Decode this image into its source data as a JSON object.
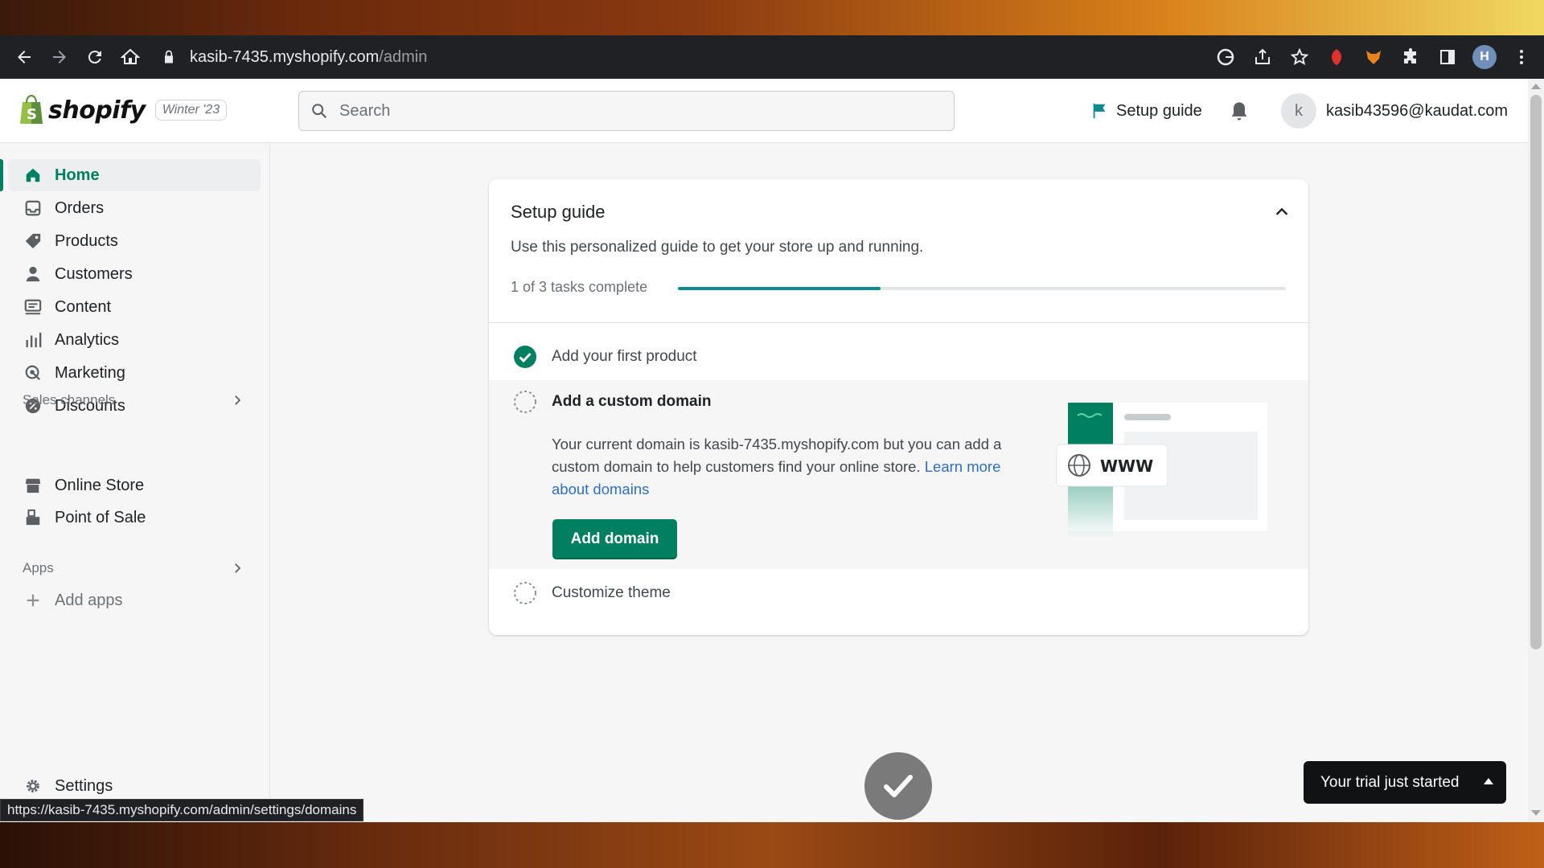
{
  "browser": {
    "url_host": "kasib-7435.myshopify.com",
    "url_path": "/admin",
    "status_url": "https://kasib-7435.myshopify.com/admin/settings/domains",
    "profile_initial": "H"
  },
  "topbar": {
    "logo_text": "shopify",
    "badge": "Winter '23",
    "search_placeholder": "Search",
    "setup_guide": "Setup guide",
    "avatar_initial": "k",
    "user_email": "kasib43596@kaudat.com"
  },
  "sidebar": {
    "items": [
      {
        "label": "Home",
        "icon": "home-icon"
      },
      {
        "label": "Orders",
        "icon": "orders-icon"
      },
      {
        "label": "Products",
        "icon": "tag-icon"
      },
      {
        "label": "Customers",
        "icon": "person-icon"
      },
      {
        "label": "Content",
        "icon": "content-icon"
      },
      {
        "label": "Analytics",
        "icon": "bar-chart-icon"
      },
      {
        "label": "Marketing",
        "icon": "target-icon"
      },
      {
        "label": "Discounts",
        "icon": "discount-icon"
      }
    ],
    "sales_channels_title": "Sales channels",
    "sales_channels": [
      {
        "label": "Online Store",
        "icon": "store-icon"
      },
      {
        "label": "Point of Sale",
        "icon": "pos-icon"
      }
    ],
    "apps_title": "Apps",
    "add_apps": "Add apps",
    "settings": "Settings"
  },
  "setup_card": {
    "title": "Setup guide",
    "subtitle": "Use this personalized guide to get your store up and running.",
    "progress_text": "1 of 3 tasks complete",
    "progress_fraction": 0.333,
    "tasks": [
      {
        "label": "Add your first product",
        "done": true
      },
      {
        "label": "Add a custom domain",
        "done": false
      },
      {
        "label": "Customize theme",
        "done": false
      }
    ],
    "domain_desc": "Your current domain is kasib-7435.myshopify.com but you can add a custom domain to help customers find your online store.",
    "learn_more": "Learn more about domains",
    "add_domain_button": "Add domain",
    "illustration_text": "WWW"
  },
  "trial_banner": "Your trial just started",
  "colors": {
    "primary": "#008060",
    "progress": "#0e8c8c",
    "link": "#2c6ecb"
  }
}
